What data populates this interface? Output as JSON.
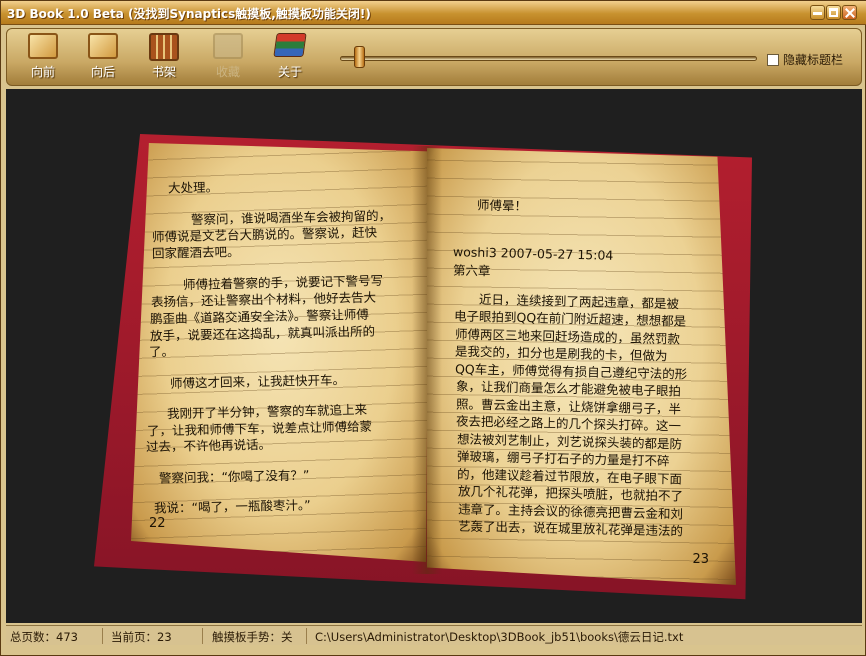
{
  "window": {
    "title": "3D Book 1.0 Beta (没找到Synaptics触摸板,触摸板功能关闭!)"
  },
  "toolbar": {
    "buttons": [
      {
        "label": "向前",
        "icon": "page-back-icon",
        "enabled": true
      },
      {
        "label": "向后",
        "icon": "page-forward-icon",
        "enabled": true
      },
      {
        "label": "书架",
        "icon": "bookshelf-icon",
        "enabled": true
      },
      {
        "label": "收藏",
        "icon": "bookmark-add-icon",
        "enabled": false
      },
      {
        "label": "关于",
        "icon": "books-stack-icon",
        "enabled": true
      }
    ],
    "page_slider_position": 0.04,
    "hide_title_checkbox": {
      "label": "隐藏标题栏",
      "checked": false
    }
  },
  "book": {
    "left_page": {
      "number": "22",
      "paragraphs": [
        [
          "大处理。"
        ],
        [
          "警察问，谁说喝酒坐车会被拘留的，",
          "师傅说是文艺台大鹏说的。警察说，赶快",
          "回家醒酒去吧。"
        ],
        [
          "师傅拉着警察的手，说要记下警号写",
          "表扬信，还让警察出个材料，他好去告大",
          "鹏歪曲《道路交通安全法》。警察让师傅",
          "放手，说要还在这捣乱，就真叫派出所的",
          "了。"
        ],
        [
          "师傅这才回来，让我赶快开车。"
        ],
        [
          "我刚开了半分钟，警察的车就追上来",
          "了，让我和师傅下车，说差点让师傅给蒙",
          "过去，不许他再说话。"
        ],
        [
          "警察问我：“你喝了没有？”"
        ],
        [
          "我说：“喝了，一瓶酸枣汁。”"
        ]
      ]
    },
    "right_page": {
      "number": "23",
      "paragraphs": [
        [
          "师傅晕！"
        ],
        [
          "woshi3 2007-05-27 15:04",
          "第六章"
        ],
        [
          "近日，连续接到了两起违章，都是被",
          "电子眼拍到QQ在前门附近超速，想想都是",
          "师傅两区三地来回赶场造成的，虽然罚款",
          "是我交的，扣分也是刷我的卡，但做为",
          "QQ车主，师傅觉得有损自己遵纪守法的形",
          "象，让我们商量怎么才能避免被电子眼拍",
          "照。曹云金出主意，让烧饼拿绷弓子，半",
          "夜去把必经之路上的几个探头打碎。这一",
          "想法被刘艺制止，刘艺说探头装的都是防",
          "弹玻璃，绷弓子打石子的力量是打不碎",
          "的，他建议趁着过节限放，在电子眼下面",
          "放几个礼花弹，把探头喷脏，也就拍不了",
          "违章了。主持会议的徐德亮把曹云金和刘",
          "艺轰了出去，说在城里放礼花弹是违法的"
        ]
      ]
    }
  },
  "statusbar": {
    "total_pages": "总页数：473",
    "current_page": "当前页：23",
    "touchpad_gesture": "触摸板手势：关",
    "file_path": "C:\\Users\\Administrator\\Desktop\\3DBook_jb51\\books\\德云日记.txt"
  }
}
